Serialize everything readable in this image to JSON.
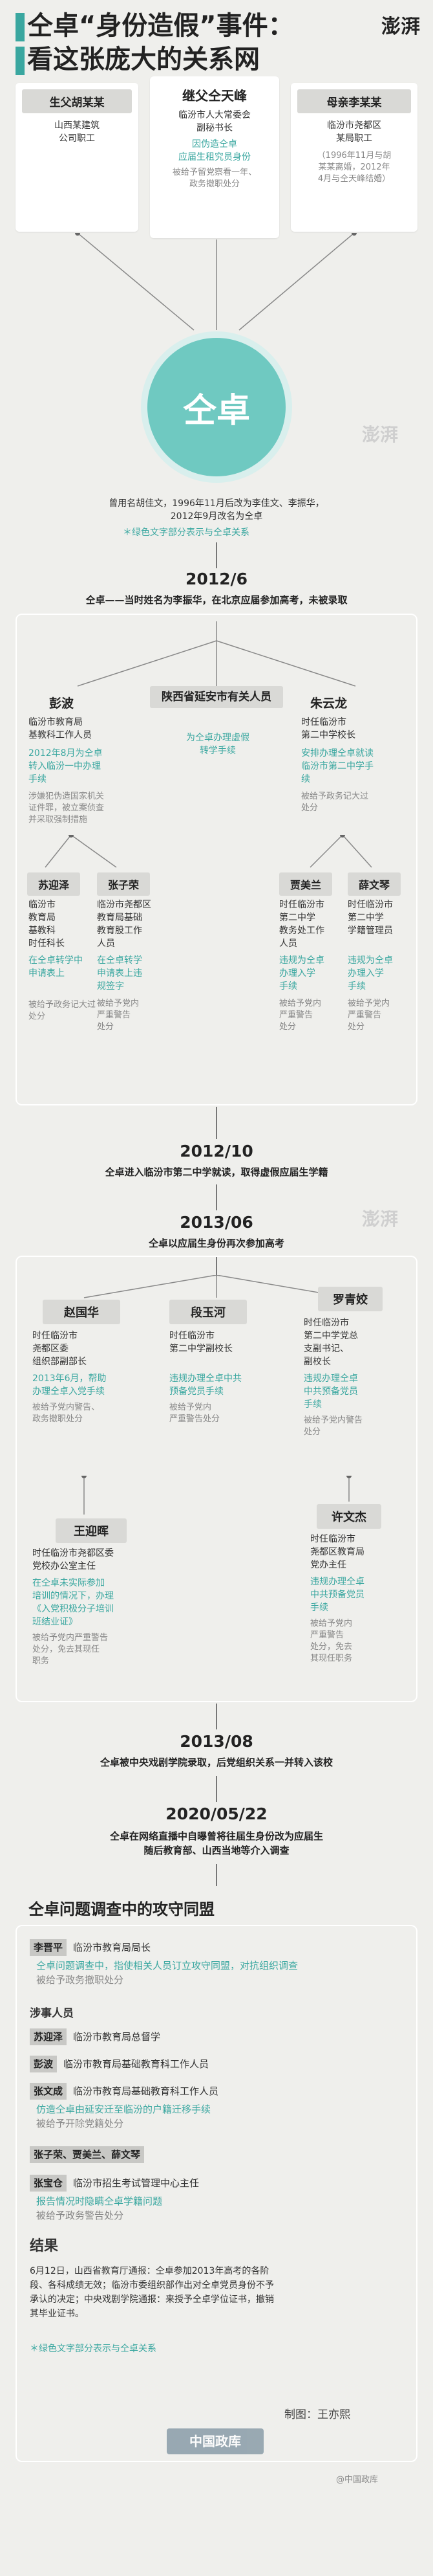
{
  "header": {
    "title_line1": "仝卓“身份造假”事件：",
    "title_line2": "看这张庞大的关系网",
    "logo": "澎湃"
  },
  "family": [
    {
      "label": "生父胡某某",
      "lines": [
        "山西某建筑",
        "公司职工"
      ]
    },
    {
      "label": "继父仝天峰",
      "lines": [
        "临汾市人大常委会",
        "副秘书长"
      ],
      "green": [
        "因伪造仝卓",
        "应届生租究员身份"
      ],
      "grey": [
        "被给予留党察看一年、",
        "政务撤职处分"
      ]
    },
    {
      "label": "母亲李某某",
      "lines": [
        "临汾市尧都区",
        "某局职工"
      ],
      "grey": [
        "（1996年11月与胡",
        "某某离婚，2012年",
        "4月与仝天峰结婚）"
      ]
    }
  ],
  "center": {
    "name": "仝卓",
    "note": [
      "曾用名胡佳文，1996年11月后改为李佳文、李振华，",
      "2012年9月改名为仝卓"
    ],
    "legend": "＊绿色文字部分表示与仝卓关系"
  },
  "e2012_6": {
    "date": "2012/6",
    "desc": "仝卓——当时姓名为李振华，在北京应届参加高考，未被录取",
    "p1": {
      "name": "彭波",
      "lines": [
        "临汾市教育局",
        "基教科工作人员"
      ],
      "green": [
        "2012年8月为仝卓",
        "转入临汾一中办理",
        "手续"
      ],
      "grey": [
        "涉嫌犯伪造国家机关",
        "证件罪，被立案侦查",
        "并采取强制措施"
      ]
    },
    "p2": {
      "name": "陕西省延安市有关人员",
      "green": [
        "为仝卓办理虚假",
        "转学手续"
      ]
    },
    "p3": {
      "name": "朱云龙",
      "lines": [
        "时任临汾市",
        "第二中学校长"
      ],
      "green": [
        "安排办理仝卓就读",
        "临汾市第二中学手",
        "续"
      ],
      "grey": [
        "被给予政务记大过",
        "处分"
      ]
    },
    "p4": {
      "name": "苏迎泽",
      "lines": [
        "临汾市",
        "教育局",
        "基教科",
        "时任科长"
      ],
      "green": [
        "在仝卓转学中",
        "申请表上"
      ],
      "grey": [
        "被给予政务记大过",
        "处分"
      ]
    },
    "p5": {
      "name": "张子荣",
      "lines": [
        "临汾市尧都区",
        "教育局基础",
        "教育股工作",
        "人员"
      ],
      "green": [
        "在仝卓转学",
        "申请表上违",
        "规签字"
      ],
      "grey": [
        "被给予党内",
        "严重警告",
        "处分"
      ]
    },
    "p6": {
      "name": "贾美兰",
      "lines": [
        "时任临汾市",
        "第二中学",
        "教务处工作",
        "人员"
      ],
      "green": [
        "违规为仝卓",
        "办理入学",
        "手续"
      ],
      "grey": [
        "被给予党内",
        "严重警告",
        "处分"
      ]
    },
    "p7": {
      "name": "薛文琴",
      "lines": [
        "时任临汾市",
        "第二中学",
        "学籍管理员"
      ],
      "green": [
        "违规为仝卓",
        "办理入学",
        "手续"
      ],
      "grey": [
        "被给予党内",
        "严重警告",
        "处分"
      ]
    }
  },
  "e2012_10": {
    "date": "2012/10",
    "desc": "仝卓进入临汾市第二中学就读，取得虚假应届生学籍"
  },
  "e2013_06": {
    "date": "2013/06",
    "desc": "仝卓以应届生身份再次参加高考",
    "q1": {
      "name": "赵国华",
      "lines": [
        "时任临汾市",
        "尧都区委",
        "组织部副部长"
      ],
      "green": [
        "2013年6月，帮助",
        "办理仝卓入党手续"
      ],
      "grey": [
        "被给予党内警告、",
        "政务撤职处分"
      ]
    },
    "q2": {
      "name": "段玉河",
      "lines": [
        "时任临汾市",
        "第二中学副校长"
      ],
      "green": [
        "违规办理仝卓中共",
        "预备党员手续"
      ],
      "grey": [
        "被给予党内",
        "严重警告处分"
      ]
    },
    "q3": {
      "name": "罗青姣",
      "lines": [
        "时任临汾市",
        "第二中学党总",
        "支副书记、",
        "副校长"
      ],
      "green": [
        "违规办理仝卓",
        "中共预备党员",
        "手续"
      ],
      "grey": [
        "被给予党内警告",
        "处分"
      ]
    },
    "q4": {
      "name": "王迎晖",
      "lines": [
        "时任临汾市尧都区委",
        "党校办公室主任"
      ],
      "green": [
        "在仝卓未实际参加",
        "培训的情况下，办理",
        "《入党积极分子培训",
        "班结业证》"
      ],
      "grey": [
        "被给予党内严重警告",
        "处分，免去其现任",
        "职务"
      ]
    },
    "q5": {
      "name": "许文杰",
      "lines": [
        "时任临汾市",
        "尧都区教育局",
        "党办主任"
      ],
      "green": [
        "违规办理仝卓",
        "中共预备党员",
        "手续"
      ],
      "grey": [
        "被给予党内",
        "严重警告",
        "处分，免去",
        "其现任职务"
      ]
    }
  },
  "e2013_08": {
    "date": "2013/08",
    "desc": "仝卓被中央戏剧学院录取，后党组织关系一并转入该校"
  },
  "e2020": {
    "date": "2020/05/22",
    "desc": [
      "仝卓在网络直播中自曝曾将往届生身份改为应届生",
      "随后教育部、山西当地等介入调查"
    ]
  },
  "alliance": {
    "title": "仝卓问题调查中的攻守同盟",
    "items": [
      {
        "tag": "李晋平",
        "text": "临汾市教育局局长",
        "green": "仝卓问题调查中，指使相关人员订立攻守同盟，对抗组织调查",
        "grey": "被给予政务撤职处分"
      },
      {
        "head": "涉事人员"
      },
      {
        "tag": "苏迎泽",
        "text": "临汾市教育局总督学"
      },
      {
        "tag": "彭波",
        "text": "临汾市教育局基础教育科工作人员"
      },
      {
        "tag": "张文成",
        "text": "临汾市教育局基础教育科工作人员",
        "green": "仿造仝卓由延安迁至临汾的户籍迁移手续",
        "grey": "被给予开除党籍处分"
      },
      {
        "tag": "张子荣、贾美兰、薛文琴",
        "text": ""
      },
      {
        "tag": "张宝仓",
        "text": "临汾市招生考试管理中心主任",
        "green": "报告情况时隐瞒仝卓学籍问题",
        "grey": "被给予政务警告处分"
      }
    ],
    "result_title": "结果",
    "result": [
      "6月12日，山西省教育厅通报：仝卓参加2013年高考的各阶",
      "段、各科成绩无效；临汾市委组织部作出对仝卓党员身份不予",
      "承认的决定；中央戏剧学院通报：来授予仝卓学位证书，撤销",
      "其毕业证书。"
    ],
    "legend": "＊绿色文字部分表示与仝卓关系",
    "credit": "制图：王亦熙"
  },
  "watermark": {
    "logo": "中国政库",
    "text": "@中国政库"
  }
}
